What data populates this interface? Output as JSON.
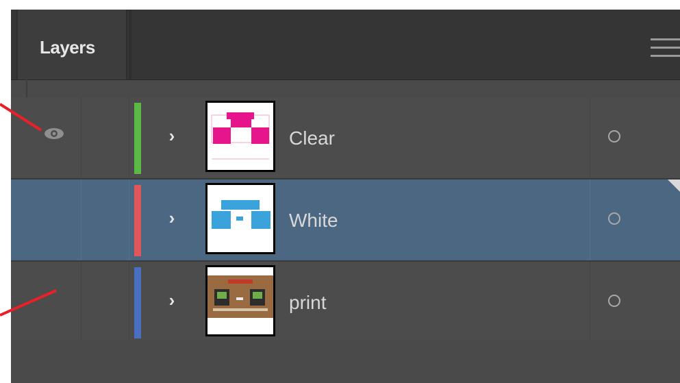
{
  "panel": {
    "tab_label": "Layers",
    "menu_icon": "hamburger-menu-icon"
  },
  "layers": [
    {
      "name": "Clear",
      "color": "#5cb946",
      "visible": true,
      "selected": false,
      "thumbnail_color": "#e6158c"
    },
    {
      "name": "White",
      "color": "#e0565a",
      "visible": false,
      "selected": true,
      "thumbnail_color": "#3aa3dc"
    },
    {
      "name": "print",
      "color": "#4a6fc0",
      "visible": false,
      "selected": false,
      "thumbnail_color": "#9a6a40"
    }
  ],
  "colors": {
    "panel_bg": "#4a4a4a",
    "selected_row": "#4c6781",
    "callout_line": "#e8202a"
  }
}
